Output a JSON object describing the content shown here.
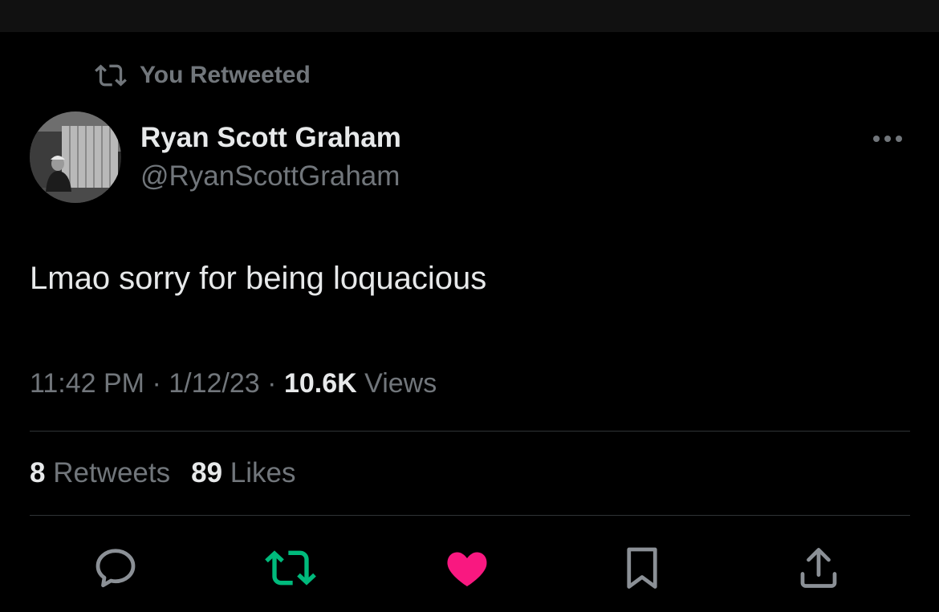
{
  "retweet_context": {
    "text": "You Retweeted",
    "icon": "retweet-icon"
  },
  "author": {
    "name": "Ryan Scott Graham",
    "handle": "@RyanScottGraham",
    "avatar": "avatar-photo"
  },
  "more_icon": "more-horizontal-icon",
  "tweet": {
    "text": "Lmao sorry for being loquacious",
    "time": "11:42 PM",
    "sep1": "·",
    "date": "1/12/23",
    "sep2": "·",
    "views_count": "10.6K",
    "views_label": "Views"
  },
  "stats": {
    "retweets_count": "8",
    "retweets_label": "Retweets",
    "likes_count": "89",
    "likes_label": "Likes"
  },
  "actions": [
    {
      "name": "reply",
      "icon": "reply-icon",
      "color": "#8b9096"
    },
    {
      "name": "retweet",
      "icon": "retweet-icon",
      "color": "#00ba7c",
      "active": true
    },
    {
      "name": "like",
      "icon": "heart-icon",
      "color": "#f91880",
      "active": true
    },
    {
      "name": "bookmark",
      "icon": "bookmark-icon",
      "color": "#8b9096"
    },
    {
      "name": "share",
      "icon": "share-icon",
      "color": "#8b9096"
    }
  ],
  "colors": {
    "background": "#000000",
    "text_primary": "#e7e9ea",
    "text_secondary": "#71767b",
    "divider": "#2f3336",
    "retweet_green": "#00ba7c",
    "like_pink": "#f91880"
  }
}
